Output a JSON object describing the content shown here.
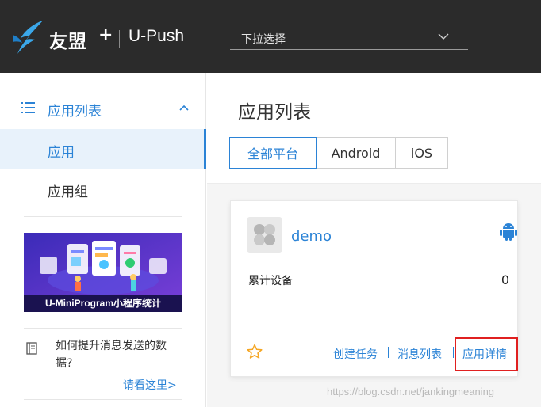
{
  "header": {
    "brand": "友盟",
    "brand_plus": "+",
    "product": "U-Push",
    "app_select_placeholder": "下拉选择",
    "logo_icon": "umeng-bird-icon"
  },
  "sidebar": {
    "section_label": "应用列表",
    "items": [
      {
        "label": "应用",
        "active": true
      },
      {
        "label": "应用组",
        "active": false
      }
    ],
    "banner_caption": "U-MiniProgram小程序统计",
    "tip_text": "如何提升消息发送的数据?",
    "tip_link": "请看这里>"
  },
  "main": {
    "page_title": "应用列表",
    "tabs": [
      {
        "label": "全部平台",
        "active": true
      },
      {
        "label": "Android",
        "active": false
      },
      {
        "label": "iOS",
        "active": false
      }
    ],
    "card": {
      "app_name": "demo",
      "platform_icon": "android-icon",
      "stat_label": "累计设备",
      "stat_value": "0",
      "actions": [
        "创建任务",
        "消息列表",
        "应用详情"
      ]
    }
  },
  "watermark": "https://blog.csdn.net/jankingmeaning",
  "colors": {
    "accent": "#2b83d6",
    "header_bg": "#2b2b2b",
    "highlight": "#e02020",
    "star": "#f5a623",
    "android": "#2b83d6"
  }
}
